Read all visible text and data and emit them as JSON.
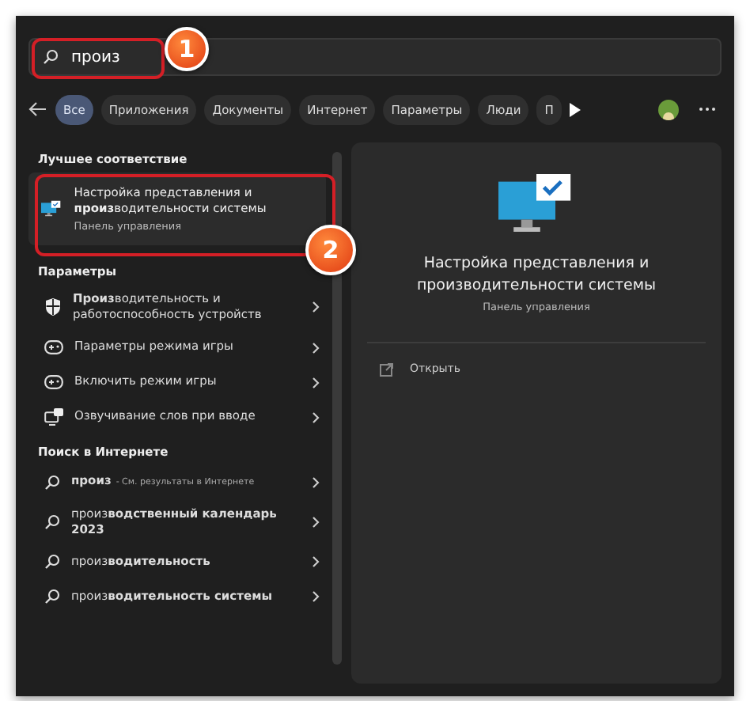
{
  "search": {
    "value": "произ"
  },
  "filters": [
    {
      "label": "Все",
      "selected": true
    },
    {
      "label": "Приложения",
      "selected": false
    },
    {
      "label": "Документы",
      "selected": false
    },
    {
      "label": "Интернет",
      "selected": false
    },
    {
      "label": "Параметры",
      "selected": false
    },
    {
      "label": "Люди",
      "selected": false
    },
    {
      "label": "П",
      "selected": false
    }
  ],
  "best_match": {
    "header": "Лучшее соответствие",
    "title": "Настройка представления и **произ**водительности системы",
    "subtitle": "Панель управления"
  },
  "settings": {
    "header": "Параметры",
    "items": [
      {
        "label": "**Произ**водительность и работоспособность устройств"
      },
      {
        "label": "Параметры режима игры"
      },
      {
        "label": "Включить режим игры"
      },
      {
        "label": "Озвучивание слов при вводе"
      }
    ]
  },
  "web": {
    "header": "Поиск в Интернете",
    "items": [
      {
        "label": "**произ**",
        "note": "- См. результаты в Интернете"
      },
      {
        "label": "произ**водственный календарь 2023**"
      },
      {
        "label": "произ**водительность**"
      },
      {
        "label": "произ**водительность системы**"
      }
    ]
  },
  "preview": {
    "title": "Настройка представления и производительности системы",
    "subtitle": "Панель управления",
    "actions": [
      {
        "label": "Открыть"
      }
    ]
  },
  "annotations": [
    {
      "label": "1"
    },
    {
      "label": "2"
    }
  ]
}
